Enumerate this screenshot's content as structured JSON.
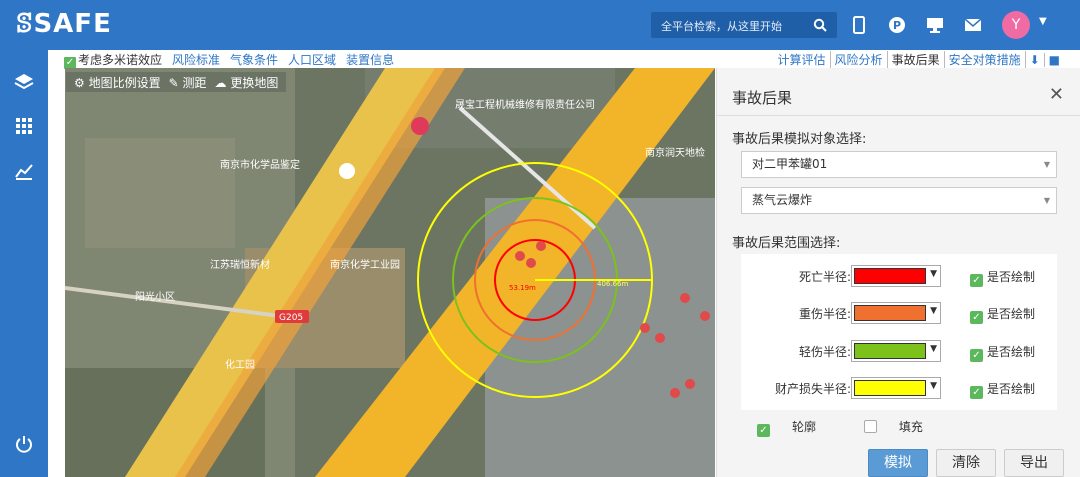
{
  "app": {
    "logo": "ꕷSAFE"
  },
  "search": {
    "placeholder": "全平台检索，从这里开始"
  },
  "user": {
    "initial": "Y"
  },
  "toolbar": {
    "checkbox_label": "考虑多米诺效应",
    "links": [
      "风险标准",
      "气象条件",
      "人口区域",
      "装置信息"
    ],
    "right_items": [
      "计算评估",
      "风险分析",
      "事故后果",
      "安全对策措施"
    ],
    "active": "事故后果"
  },
  "map": {
    "tools": [
      "地图比例设置",
      "测距",
      "更换地图"
    ],
    "labels": {
      "place1": "南京市化学品鉴定",
      "place2": "江苏瑞恒新材",
      "place3": "南京化学工业园",
      "place4": "阳光小区",
      "place5": "化工园",
      "road_tag": "G205",
      "station": "南京润天地检",
      "factory": "晟宝工程机械维修有限责任公司",
      "radius_red": "53.19m",
      "radius_yellow": "406.66m"
    }
  },
  "panel": {
    "title": "事故后果",
    "target_label": "事故后果模拟对象选择:",
    "target_value": "对二甲苯罐01",
    "accident_value": "蒸气云爆炸",
    "range_label": "事故后果范围选择:",
    "rows": [
      {
        "label": "死亡半径:",
        "color": "#ff0000",
        "draw": "是否绘制"
      },
      {
        "label": "重伤半径:",
        "color": "#f07030",
        "draw": "是否绘制"
      },
      {
        "label": "轻伤半径:",
        "color": "#7cc21a",
        "draw": "是否绘制"
      },
      {
        "label": "财产损失半径:",
        "color": "#ffff00",
        "draw": "是否绘制"
      }
    ],
    "opt_outline": "轮廓",
    "opt_fill": "填充",
    "btn_simulate": "模拟",
    "btn_clear": "清除",
    "btn_export": "导出"
  }
}
